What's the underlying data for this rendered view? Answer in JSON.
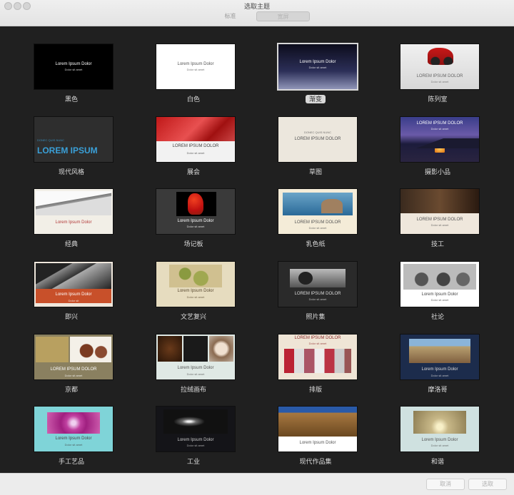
{
  "window": {
    "title": "选取主题"
  },
  "tabs": {
    "standard": "标准",
    "wide": "宽屏"
  },
  "buttons": {
    "cancel": "取消",
    "choose": "选取"
  },
  "themes": [
    {
      "label": "黑色",
      "title": "Lorem Ipsum Dolor",
      "sub": "Dolor sit amet"
    },
    {
      "label": "白色",
      "title": "Lorem Ipsum Dolor",
      "sub": "Dolor sit amet"
    },
    {
      "label": "渐变",
      "title": "Lorem Ipsum Dolor",
      "sub": "Dolor sit amet"
    },
    {
      "label": "陈列室",
      "title": "LOREM IPSUM DOLOR",
      "sub": "Dolor sit amet"
    },
    {
      "label": "现代风格",
      "title": "LOREM IPSUM",
      "sub": "DONEC QUIS NUNC"
    },
    {
      "label": "展会",
      "title": "LOREM IPSUM DOLOR",
      "sub": "Dolor sit amet"
    },
    {
      "label": "草图",
      "title": "LOREM IPSUM DOLOR",
      "sub": "DONEC QUIS NUNC"
    },
    {
      "label": "摄影小品",
      "title": "LOREM IPSUM DOLOR",
      "sub": "Dolor sit amet"
    },
    {
      "label": "经典",
      "title": "Lorem Ipsum Dolor",
      "sub": ""
    },
    {
      "label": "场记板",
      "title": "Lorem Ipsum Dolor",
      "sub": "Dolor sit amet"
    },
    {
      "label": "乳色纸",
      "title": "LOREM IPSUM DOLOR",
      "sub": "Dolor sit amet"
    },
    {
      "label": "技工",
      "title": "LOREM IPSUM DOLOR",
      "sub": "Dolor sit amet"
    },
    {
      "label": "即兴",
      "title": "Lorem Ipsum Dolor",
      "sub": "Dolor sit"
    },
    {
      "label": "文艺复兴",
      "title": "Lorem Ipsum Dolor",
      "sub": "Dolor sit amet"
    },
    {
      "label": "照片集",
      "title": "LOREM IPSUM DOLOR",
      "sub": "Dolor sit amet"
    },
    {
      "label": "社论",
      "title": "Lorem Ipsum Dolor",
      "sub": "Dolor sit amet"
    },
    {
      "label": "京都",
      "title": "LOREM IPSUM DOLOR",
      "sub": "Dolor sit amet"
    },
    {
      "label": "拉绒画布",
      "title": "Lorem Ipsum Dolor",
      "sub": "Dolor sit amet"
    },
    {
      "label": "排版",
      "title": "LOREM IPSUM DOLOR",
      "sub": "Dolor sit amet"
    },
    {
      "label": "摩洛哥",
      "title": "Lorem Ipsum Dolor",
      "sub": "Dolor sit amet"
    },
    {
      "label": "手工艺品",
      "title": "Lorem Ipsum Dolor",
      "sub": "Dolor sit amet"
    },
    {
      "label": "工业",
      "title": "Lorem Ipsum Dolor",
      "sub": "Dolor sit amet"
    },
    {
      "label": "现代作品集",
      "title": "Lorem Ipsum Dolor",
      "sub": ""
    },
    {
      "label": "和谐",
      "title": "Lorem Ipsum Dolor",
      "sub": "Dolor sit amet"
    }
  ]
}
